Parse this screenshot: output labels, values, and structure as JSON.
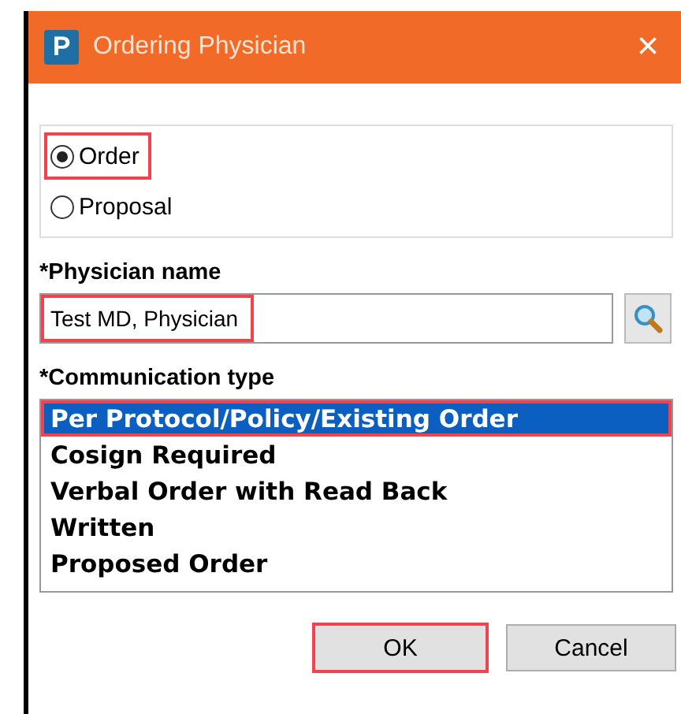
{
  "window": {
    "title": "Ordering Physician",
    "icon_letter": "P",
    "close": "×"
  },
  "mode_options": [
    {
      "label": "Order",
      "selected": true,
      "highlighted": true
    },
    {
      "label": "Proposal",
      "selected": false,
      "highlighted": false
    }
  ],
  "physician_name": {
    "label": "*Physician name",
    "value": "Test MD, Physician",
    "highlighted": true
  },
  "communication_type": {
    "label": "*Communication type",
    "items": [
      {
        "label": "Per Protocol/Policy/Existing Order",
        "selected": true,
        "highlighted": true
      },
      {
        "label": "Cosign Required",
        "selected": false,
        "highlighted": false
      },
      {
        "label": "Verbal Order with Read Back",
        "selected": false,
        "highlighted": false
      },
      {
        "label": "Written",
        "selected": false,
        "highlighted": false
      },
      {
        "label": "Proposed Order",
        "selected": false,
        "highlighted": false
      }
    ]
  },
  "buttons": [
    {
      "label": "OK",
      "highlighted": true
    },
    {
      "label": "Cancel",
      "highlighted": false
    }
  ]
}
